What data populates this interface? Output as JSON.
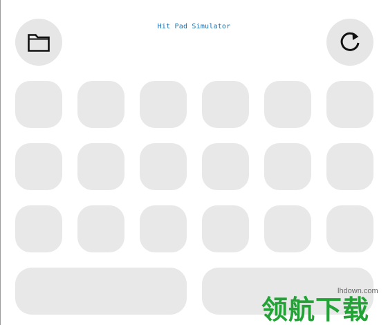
{
  "app": {
    "title": "Hit Pad Simulator"
  },
  "toolbar": {
    "open_icon": "folder-icon",
    "reset_icon": "refresh-icon"
  },
  "pads": {
    "rows": 3,
    "columns": 6,
    "wide_pads": 2
  },
  "watermark": {
    "domain": "lhdown.com",
    "text": "领航下载",
    "color": "#23a336"
  },
  "colors": {
    "title": "#1a6fb0",
    "pad": "#e8e8e8",
    "button": "#e6e6e6"
  }
}
